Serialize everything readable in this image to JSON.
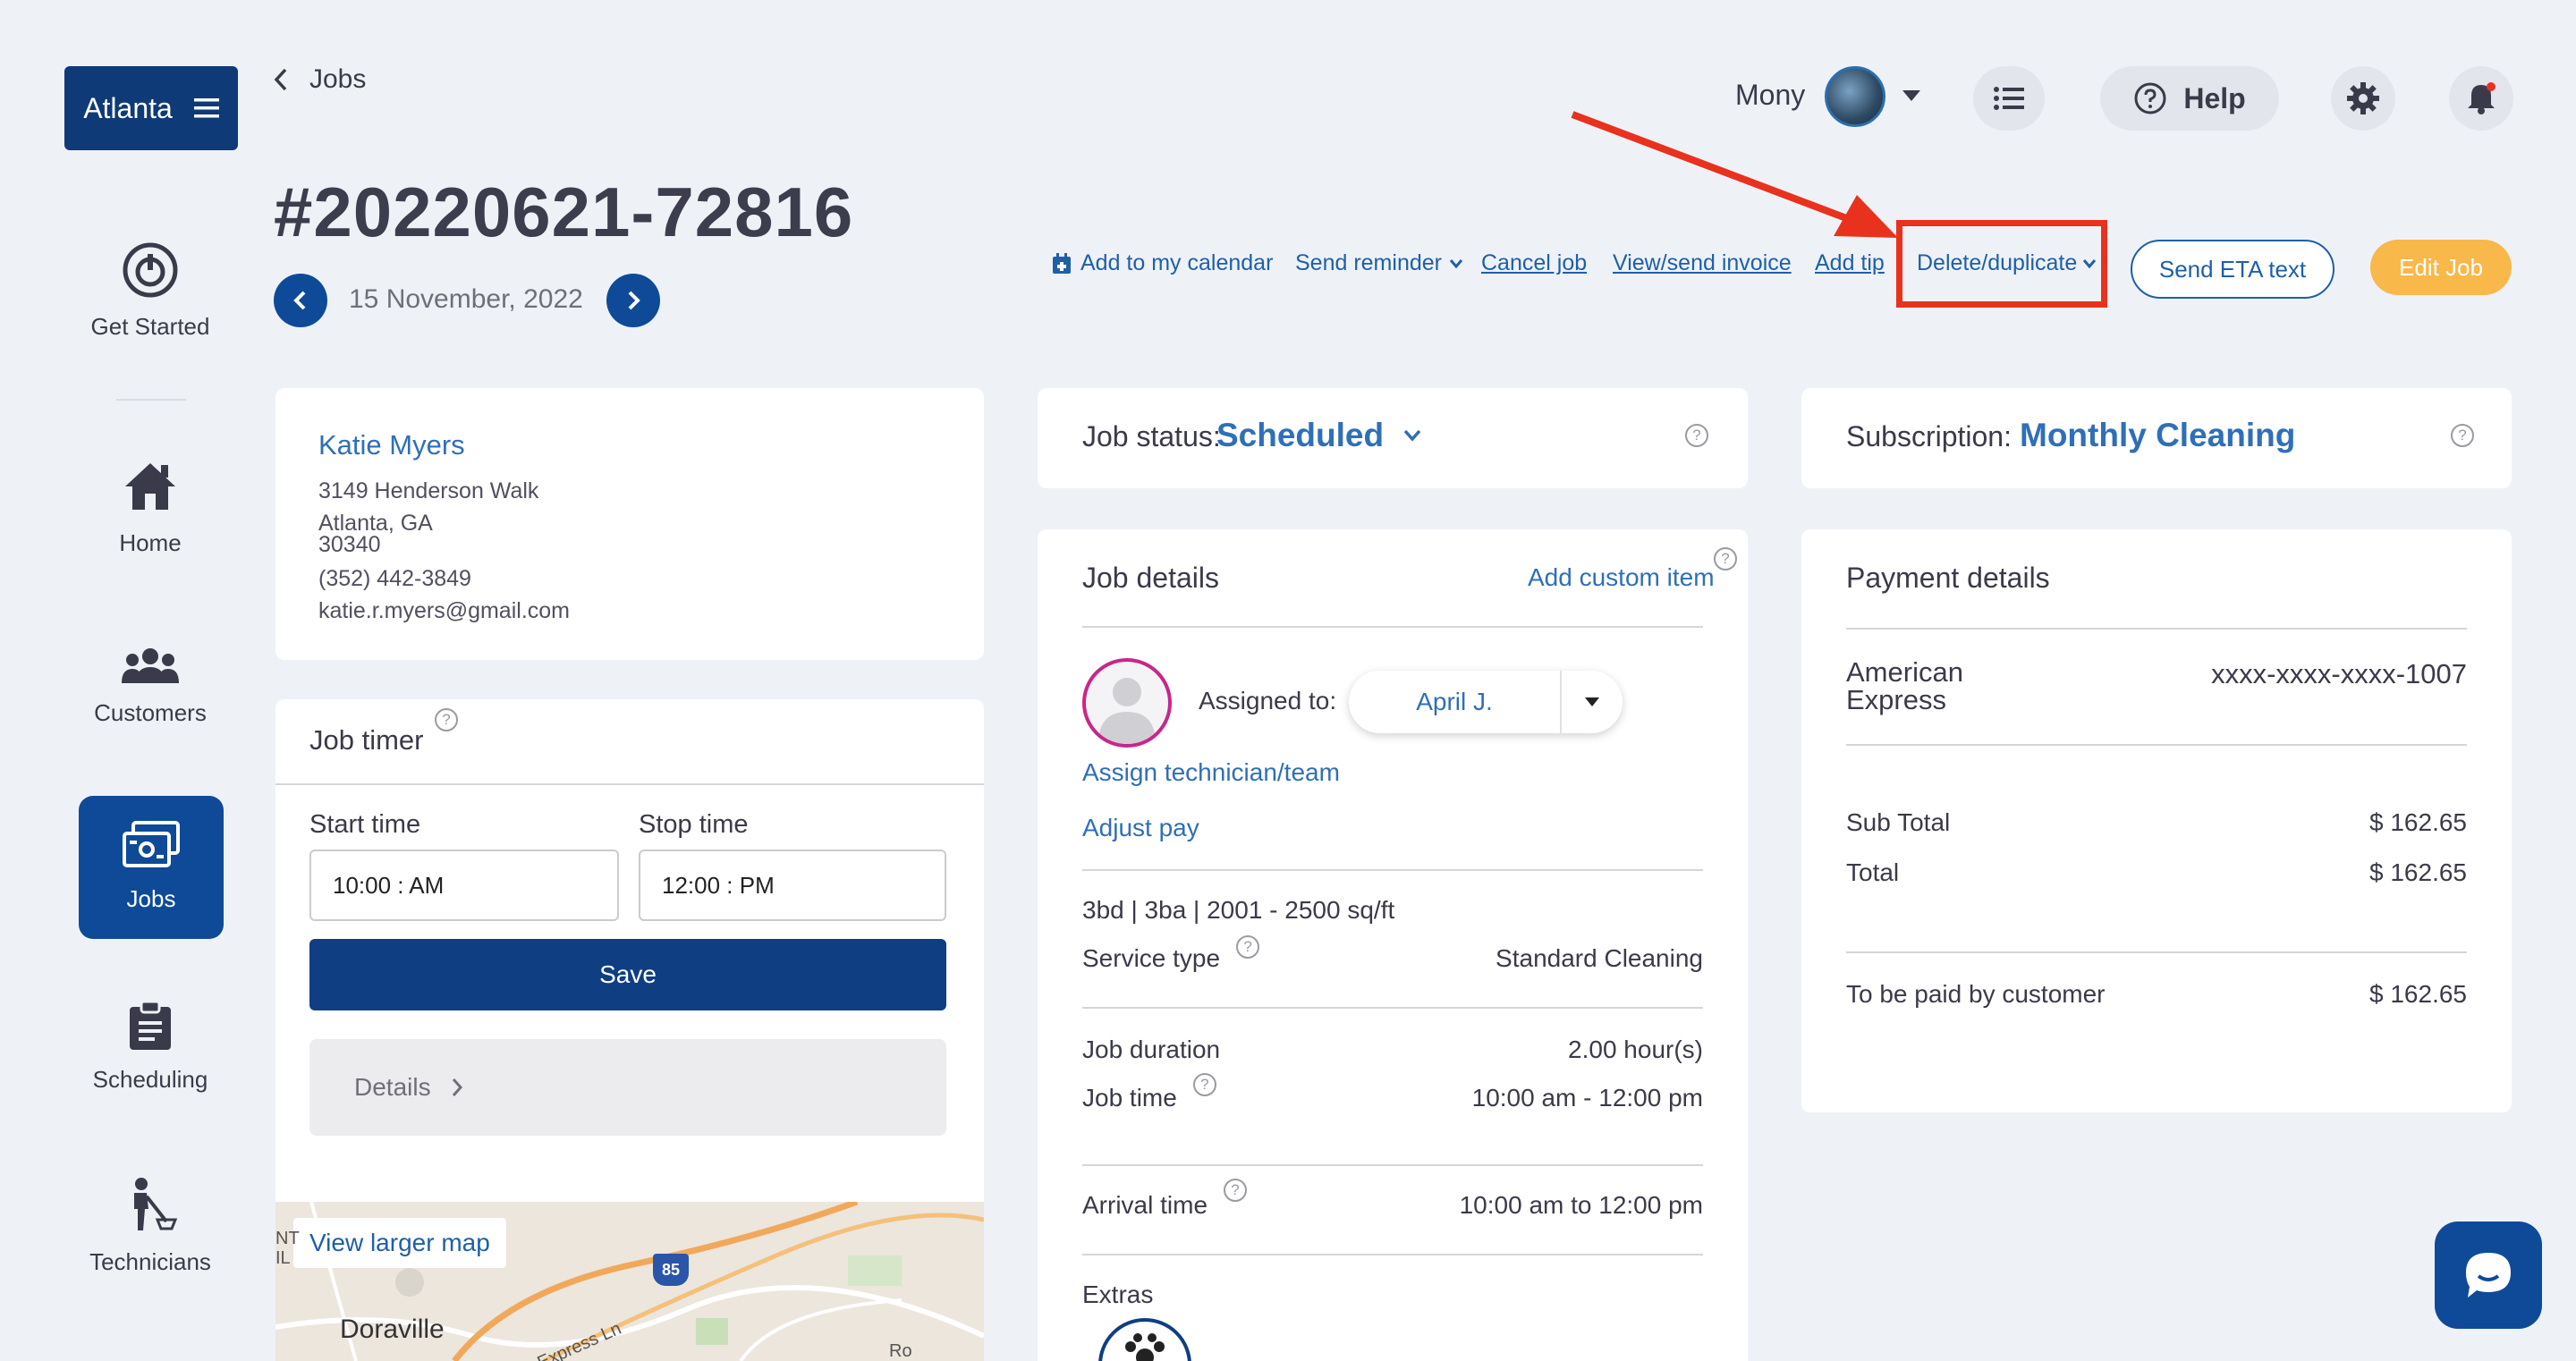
{
  "sidebar": {
    "city": "Atlanta",
    "items": [
      {
        "label": "Get Started",
        "icon": "power-icon"
      },
      {
        "label": "Home",
        "icon": "home-icon"
      },
      {
        "label": "Customers",
        "icon": "customers-icon"
      },
      {
        "label": "Jobs",
        "icon": "jobs-icon",
        "active": true
      },
      {
        "label": "Scheduling",
        "icon": "clipboard-icon"
      },
      {
        "label": "Technicians",
        "icon": "technician-icon"
      }
    ]
  },
  "header": {
    "back_label": "Jobs",
    "job_number": "#20220621-72816",
    "date": "15 November, 2022",
    "user_name": "Mony",
    "help_label": "Help"
  },
  "actions": {
    "add_calendar": "Add to my calendar",
    "send_reminder": "Send reminder",
    "cancel_job": "Cancel job",
    "view_invoice": "View/send invoice",
    "add_tip": "Add tip",
    "delete_duplicate": "Delete/duplicate",
    "send_eta": "Send ETA text",
    "edit_job": "Edit Job"
  },
  "customer": {
    "name": "Katie Myers",
    "street": "3149 Henderson Walk",
    "city_state": "Atlanta, GA",
    "zip": "30340",
    "phone": "(352) 442-3849",
    "email": "katie.r.myers@gmail.com"
  },
  "job_timer": {
    "title": "Job timer",
    "start_label": "Start time",
    "stop_label": "Stop time",
    "start_value": "10:00 : AM",
    "stop_value": "12:00 : PM",
    "save_label": "Save",
    "details_label": "Details"
  },
  "map": {
    "view_larger": "View larger map",
    "place": "Doraville",
    "highway": "85",
    "road": "Express Ln",
    "edge_text": [
      "NT",
      "IL",
      "Ro"
    ]
  },
  "job_status": {
    "label": "Job status:",
    "value": "Scheduled"
  },
  "job_details": {
    "title": "Job details",
    "add_custom": "Add custom item",
    "assigned_label": "Assigned to:",
    "assigned_value": "April J.",
    "assign_link": "Assign technician/team",
    "adjust_pay": "Adjust pay",
    "home_size": "3bd | 3ba | 2001 - 2500 sq/ft",
    "service_type_label": "Service type",
    "service_type_value": "Standard Cleaning",
    "duration_label": "Job duration",
    "duration_value": "2.00 hour(s)",
    "job_time_label": "Job time",
    "job_time_value": "10:00 am - 12:00 pm",
    "arrival_label": "Arrival time",
    "arrival_value": "10:00 am to 12:00 pm",
    "extras_label": "Extras"
  },
  "subscription": {
    "label": "Subscription:",
    "value": "Monthly Cleaning"
  },
  "payment": {
    "title": "Payment details",
    "card_brand_line1": "American",
    "card_brand_line2": "Express",
    "card_number": "xxxx-xxxx-xxxx-1007",
    "subtotal_label": "Sub Total",
    "subtotal_value": "$ 162.65",
    "total_label": "Total",
    "total_value": "$ 162.65",
    "paid_by_label": "To be paid by customer",
    "paid_by_value": "$ 162.65"
  },
  "colors": {
    "brand_navy": "#0f4a98",
    "accent_orange": "#f8b84a",
    "highlight_red": "#e8321e",
    "link_blue": "#2f6fb7"
  }
}
